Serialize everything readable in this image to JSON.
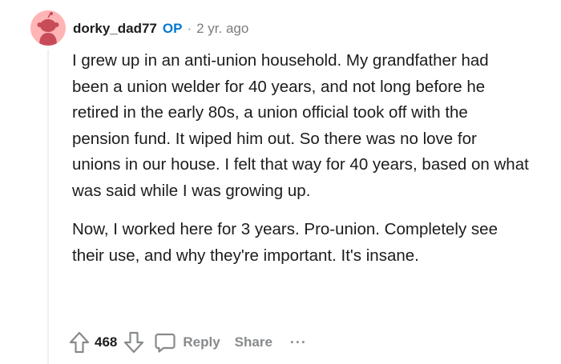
{
  "comment": {
    "author": "dorky_dad77",
    "op_badge": "OP",
    "separator": "·",
    "timestamp": "2 yr. ago",
    "paragraphs": [
      "I grew up in an anti-union household. My grandfather had been a union welder for 40 years, and not long before he retired in the early 80s, a union official took off with the pension fund. It wiped him out. So there was no love for unions in our house. I felt that way for 40 years, based on what was said while I was growing up.",
      "Now, I worked here for 3 years. Pro-union. Completely see their use, and why they're important. It's insane."
    ]
  },
  "actions": {
    "upvote_icon": "upvote-arrow-icon",
    "vote_count": "468",
    "downvote_icon": "downvote-arrow-icon",
    "reply_icon": "speech-bubble-icon",
    "reply_label": "Reply",
    "share_label": "Share",
    "more_label": "···"
  },
  "colors": {
    "avatar_bg": "#ffb5b5",
    "avatar_figure": "#c84b5a",
    "op_badge": "#0079d3",
    "muted": "#878a8c",
    "text": "#1c1c1c"
  }
}
